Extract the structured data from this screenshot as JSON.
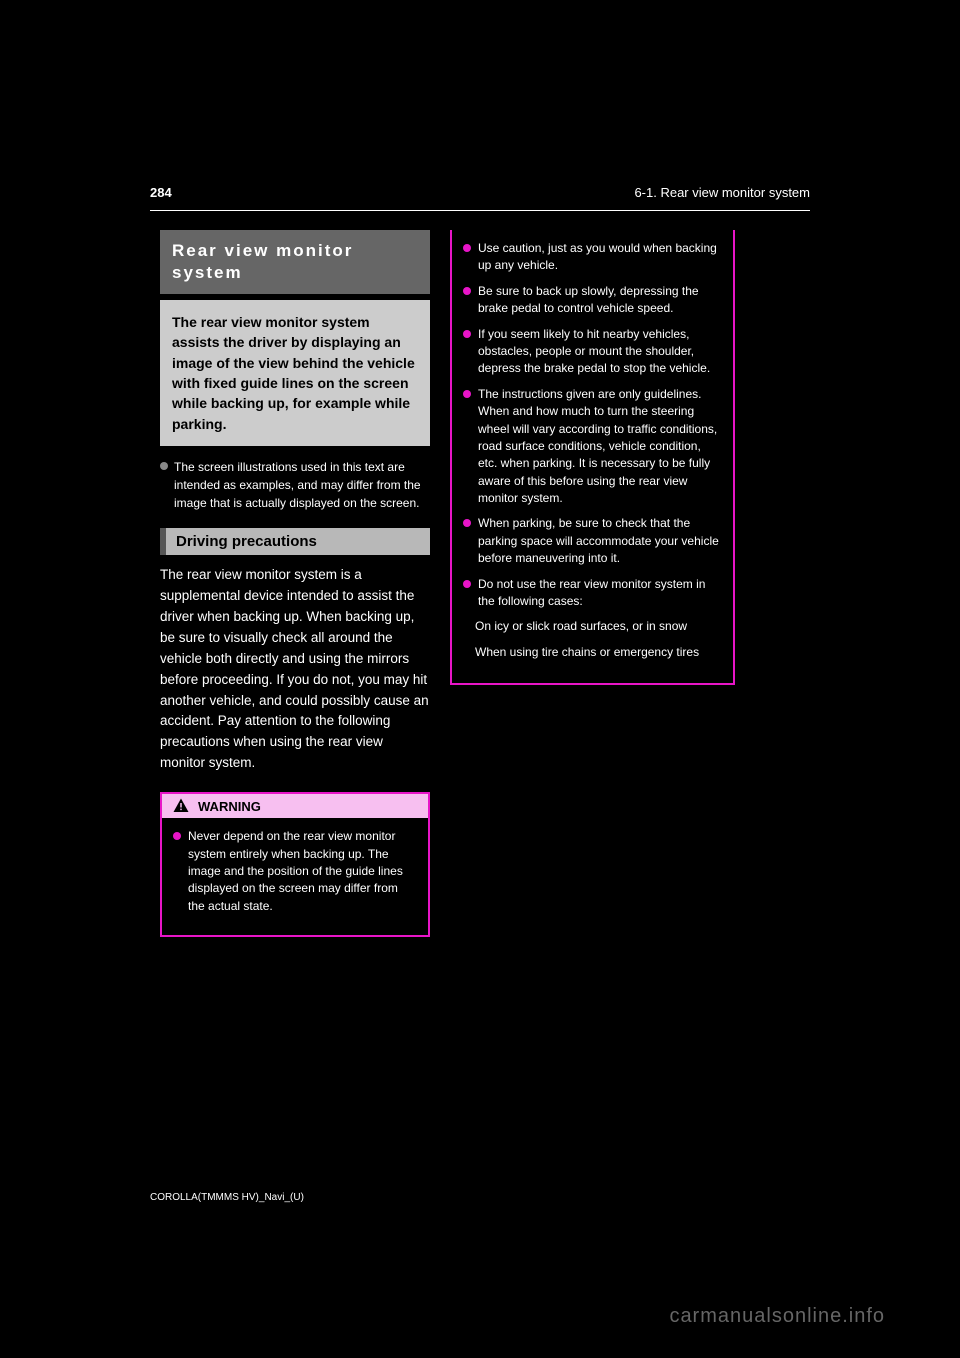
{
  "header": {
    "page_number": "284",
    "chapter": "6-1. Rear view monitor system"
  },
  "section": {
    "title": "Rear view monitor system",
    "intro": "The rear view monitor system assists the driver by displaying an image of the view behind the vehicle with fixed guide lines on the screen while backing up, for example while parking."
  },
  "note": {
    "text": "The screen illustrations used in this text are intended as examples, and may differ from the image that is actually displayed on the screen."
  },
  "subsection": {
    "title": "Driving precautions",
    "body": "The rear view monitor system is a supplemental device intended to assist the driver when backing up. When backing up, be sure to visually check all around the vehicle both directly and using the mirrors before proceeding. If you do not, you may hit another vehicle, and could possibly cause an accident.\nPay attention to the following precautions when using the rear view monitor system."
  },
  "warning": {
    "label": "WARNING",
    "items": [
      "Never depend on the rear view monitor system entirely when backing up. The image and the position of the guide lines displayed on the screen may differ from the actual state.",
      "Use caution, just as you would when backing up any vehicle.",
      "Be sure to back up slowly, depressing the brake pedal to control vehicle speed.",
      "If you seem likely to hit nearby vehicles, obstacles, people or mount the shoulder, depress the brake pedal to stop the vehicle.",
      "The instructions given are only guidelines. When and how much to turn the steering wheel will vary according to traffic conditions, road surface conditions, vehicle condition, etc. when parking. It is necessary to be fully aware of this before using the rear view monitor system.",
      "When parking, be sure to check that the parking space will accommodate your vehicle before maneuvering into it.",
      "Do not use the rear view monitor system in the following cases:",
      "On icy or slick road surfaces, or in snow",
      "When using tire chains or emergency tires"
    ]
  },
  "footer": {
    "model": "COROLLA(TMMMS HV)_Navi_(U)",
    "watermark": "carmanualsonline.info"
  }
}
